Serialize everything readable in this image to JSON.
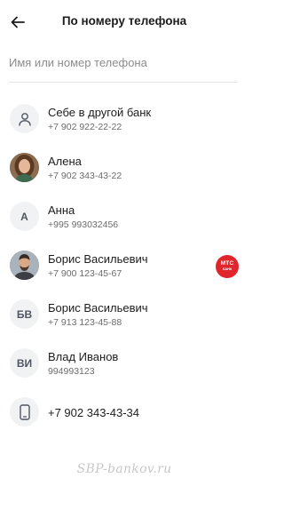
{
  "header": {
    "title": "По номеру телефона",
    "back_icon": "arrow-left-icon"
  },
  "search": {
    "placeholder": "Имя или номер телефона",
    "value": ""
  },
  "contacts": [
    {
      "name": "Себе в другой банк",
      "phone": "+7 902 922-22-22",
      "avatar_type": "person-icon",
      "initials": ""
    },
    {
      "name": "Алена",
      "phone": "+7 902 343-43-22",
      "avatar_type": "photo",
      "initials": ""
    },
    {
      "name": "Анна",
      "phone": "+995 993032456",
      "avatar_type": "initials",
      "initials": "А"
    },
    {
      "name": "Борис Васильевич",
      "phone": "+7 900 123-45-67",
      "avatar_type": "photo",
      "initials": "",
      "bank_badge": {
        "line1": "МТС",
        "line2": "БАНК",
        "color": "#e0262c"
      }
    },
    {
      "name": "Борис Васильевич",
      "phone": "+7 913 123-45-88",
      "avatar_type": "initials",
      "initials": "БВ"
    },
    {
      "name": "Влад Иванов",
      "phone": "994993123",
      "avatar_type": "initials",
      "initials": "ВИ"
    },
    {
      "name": "+7 902 343-43-34",
      "avatar_type": "phone-icon"
    }
  ],
  "watermark": "SBP-bankov.ru",
  "colors": {
    "avatar_bg": "#f1f2f4",
    "badge_red": "#e0262c",
    "text_secondary": "#6b6b6b"
  }
}
